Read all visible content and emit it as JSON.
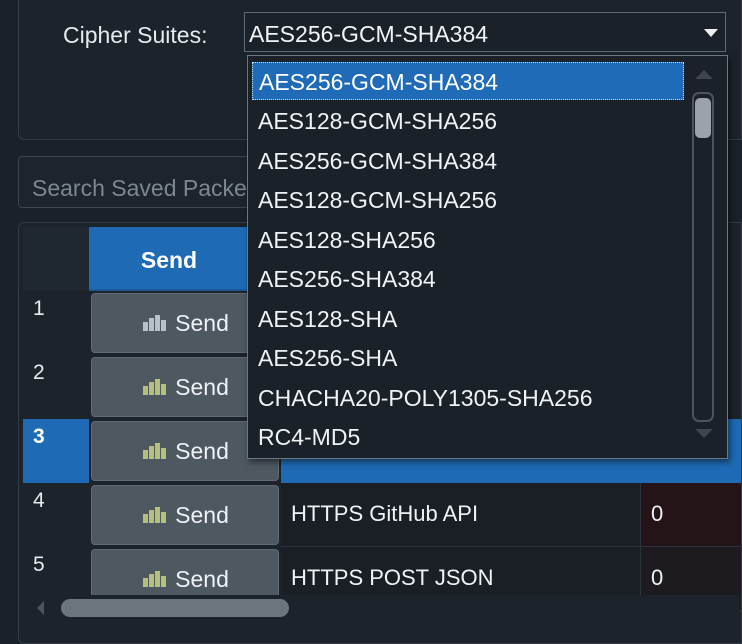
{
  "cipher": {
    "label": "Cipher Suites:",
    "selected": "AES256-GCM-SHA384",
    "options": [
      "AES256-GCM-SHA384",
      "AES128-GCM-SHA256",
      "AES256-GCM-SHA384",
      "AES128-GCM-SHA256",
      "AES128-SHA256",
      "AES256-SHA384",
      "AES128-SHA",
      "AES256-SHA",
      "CHACHA20-POLY1305-SHA256",
      "RC4-MD5"
    ]
  },
  "search": {
    "placeholder": "Search Saved Packets"
  },
  "table": {
    "send_header": "Send",
    "rows": [
      {
        "num": "1",
        "send_label": "Send",
        "name": "",
        "value": ""
      },
      {
        "num": "2",
        "send_label": "Send",
        "name": "",
        "value": ""
      },
      {
        "num": "3",
        "send_label": "Send",
        "name": "",
        "value": ""
      },
      {
        "num": "4",
        "send_label": "Send",
        "name": "HTTPS GitHub API",
        "value": "0"
      },
      {
        "num": "5",
        "send_label": "Send",
        "name": "HTTPS POST JSON",
        "value": "0"
      }
    ],
    "selected_row": "3"
  },
  "colors": {
    "accent": "#1e6ab4",
    "background": "#1a2129",
    "button": "#4d5861"
  },
  "icons": {
    "send": "send-packet-icon",
    "dropdown": "chevron-down-icon"
  }
}
